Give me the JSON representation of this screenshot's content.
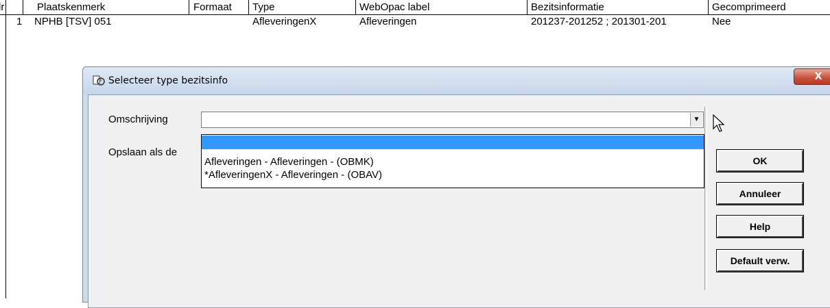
{
  "table": {
    "headers": [
      "Nr",
      "Plaatskenmerk",
      "Formaat",
      "Type",
      "WebOpac label",
      "Bezitsinformatie",
      "Gecomprimeerd"
    ],
    "header_visible": [
      "lr",
      "Plaatskenmerk",
      "Formaat",
      "Type",
      "WebOpac label",
      "Bezitsinformatie",
      "Gecomprimeerd"
    ],
    "rows": [
      [
        "1",
        "NPHB [TSV] 051",
        "",
        "AfleveringenX",
        "Afleveringen",
        "201237-201252 ; 201301-201",
        "Nee"
      ]
    ]
  },
  "dialog": {
    "title": "Selecteer type bezitsinfo",
    "close_label": "X",
    "omschrijving_label": "Omschrijving",
    "omschrijving_value": "",
    "opslaan_label": "Opslaan als de",
    "dropdown_options": [
      "",
      "Afleveringen - Afleveringen - (OBMK)",
      "*AfleveringenX - Afleveringen - (OBAV)"
    ],
    "buttons": {
      "ok": "OK",
      "annuleer": "Annuleer",
      "help": "Help",
      "default": "Default verw."
    }
  },
  "colors": {
    "selection": "#3399ff",
    "dialog_frame": "#cfdcea",
    "close_button": "#c8503a"
  },
  "icons": [
    "dialog-app-icon",
    "close-icon",
    "combo-arrow-icon",
    "mouse-pointer-icon"
  ]
}
